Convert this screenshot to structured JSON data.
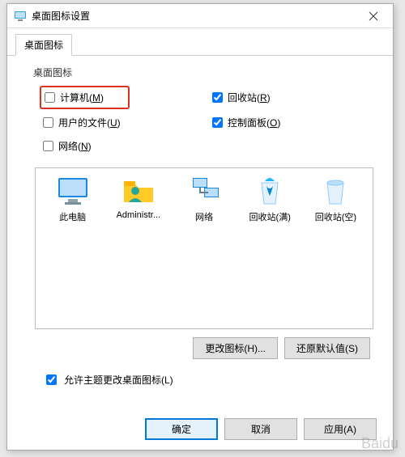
{
  "window": {
    "title": "桌面图标设置"
  },
  "tab": {
    "label": "桌面图标"
  },
  "group": {
    "label": "桌面图标"
  },
  "checks": {
    "computer": {
      "label": "计算机(",
      "key": "M",
      "tail": ")",
      "checked": false
    },
    "recyclebin": {
      "label": "回收站(",
      "key": "R",
      "tail": ")",
      "checked": true
    },
    "userfiles": {
      "label": "用户的文件(",
      "key": "U",
      "tail": ")",
      "checked": false
    },
    "controlpanel": {
      "label": "控制面板(",
      "key": "O",
      "tail": ")",
      "checked": true
    },
    "network": {
      "label": "网络(",
      "key": "N",
      "tail": ")",
      "checked": false
    }
  },
  "icons": {
    "thispc": "此电脑",
    "admin": "Administr...",
    "network": "网络",
    "rbfull": "回收站(满)",
    "rbempty": "回收站(空)"
  },
  "buttons": {
    "changeicon": "更改图标(H)...",
    "restore": "还原默认值(S)",
    "ok": "确定",
    "cancel": "取消",
    "apply": "应用(A)"
  },
  "themeCheck": {
    "label": "允许主题更改桌面图标(L)",
    "checked": true
  },
  "watermark": "Baidu"
}
